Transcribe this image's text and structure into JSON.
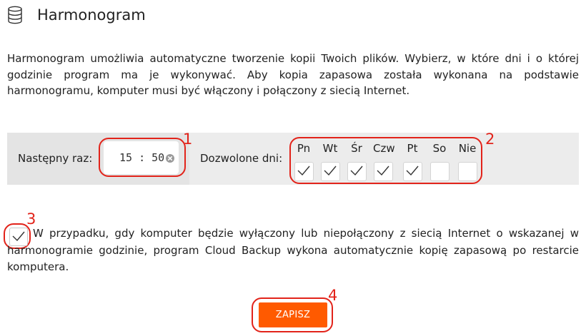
{
  "header": {
    "title": "Harmonogram",
    "icon": "database-icon"
  },
  "intro": {
    "text": "Harmonogram umożliwia automatyczne tworzenie kopii Twoich plików. Wybierz, w które dni i o której godzinie program ma je wykonywać. Aby kopia zapasowa została wykonana na podstawie harmonogramu, komputer musi być włączony i połączony z siecią Internet."
  },
  "schedule": {
    "next_label": "Następny raz:",
    "time_value": "15 : 50",
    "days_label": "Dozwolone dni:",
    "days": [
      {
        "label": "Pn",
        "checked": true
      },
      {
        "label": "Wt",
        "checked": true
      },
      {
        "label": "Śr",
        "checked": true
      },
      {
        "label": "Czw",
        "checked": true
      },
      {
        "label": "Pt",
        "checked": true
      },
      {
        "label": "So",
        "checked": false
      },
      {
        "label": "Nie",
        "checked": false
      }
    ]
  },
  "fallback": {
    "checked": true,
    "text": "W przypadku, gdy komputer będzie wyłączony lub niepołączony z siecią Internet o wskazanej w harmonogramie godzinie, program Cloud Backup wykona automatycznie kopię zapasową po restarcie komputera."
  },
  "save": {
    "label": "ZAPISZ"
  },
  "annotations": {
    "n1": "1",
    "n2": "2",
    "n3": "3",
    "n4": "4"
  },
  "colors": {
    "accent": "#ff5a00",
    "annotation": "#e2231a",
    "panel": "#ececec"
  }
}
